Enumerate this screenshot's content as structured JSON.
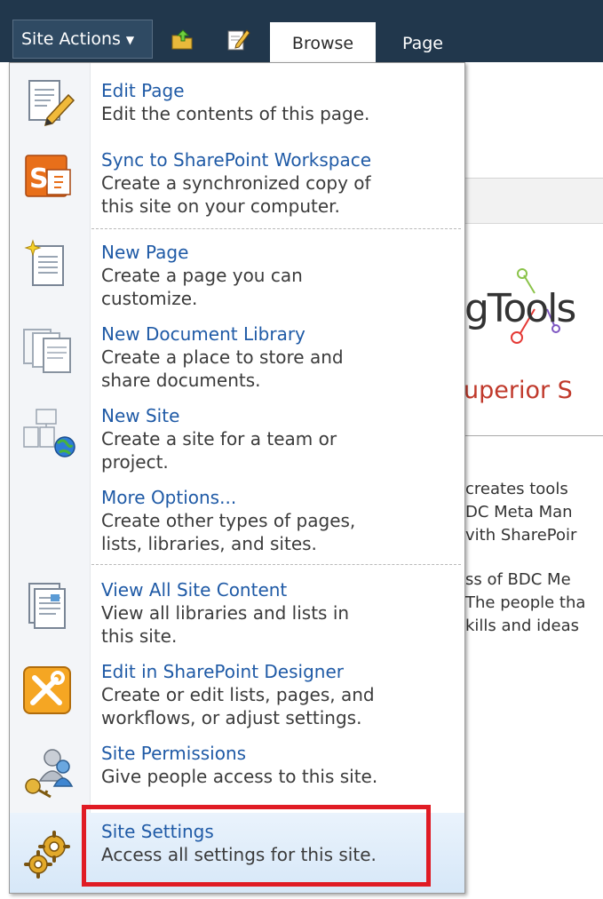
{
  "topbar": {
    "site_actions_label": "Site Actions",
    "tabs": [
      {
        "label": "Browse",
        "selected": true
      },
      {
        "label": "Page",
        "selected": false
      }
    ]
  },
  "background_page": {
    "logo_text": "gTools",
    "headline": "uperior S",
    "paragraph1": [
      "creates tools",
      "DC Meta Man",
      "vith SharePoir"
    ],
    "paragraph2": [
      "ss of BDC Me",
      "The people tha",
      "kills and ideas"
    ]
  },
  "menu": {
    "items": [
      {
        "title": "Edit Page",
        "desc": [
          "Edit the contents of this page."
        ],
        "icon": "edit-page-icon"
      },
      {
        "title": "Sync to SharePoint Workspace",
        "desc": [
          "Create a synchronized copy of",
          "this site on your computer."
        ],
        "icon": "sharepoint-workspace-icon"
      },
      {
        "title": "New Page",
        "desc": [
          "Create a page you can",
          "customize."
        ],
        "icon": "new-page-icon"
      },
      {
        "title": "New Document Library",
        "desc": [
          "Create a place to store and",
          "share documents."
        ],
        "icon": "document-library-icon"
      },
      {
        "title": "New Site",
        "desc": [
          "Create a site for a team or",
          "project."
        ],
        "icon": "new-site-icon"
      },
      {
        "title": "More Options...",
        "desc": [
          "Create other types of pages,",
          "lists, libraries, and sites."
        ],
        "icon": ""
      },
      {
        "title": "View All Site Content",
        "desc": [
          "View all libraries and lists in",
          "this site."
        ],
        "icon": "site-content-icon"
      },
      {
        "title": "Edit in SharePoint Designer",
        "desc": [
          "Create or edit lists, pages, and",
          "workflows, or adjust settings."
        ],
        "icon": "sharepoint-designer-icon"
      },
      {
        "title": "Site Permissions",
        "desc": [
          "Give people access to this site."
        ],
        "icon": "permissions-icon"
      },
      {
        "title": "Site Settings",
        "desc": [
          "Access all settings for this site."
        ],
        "icon": "gears-icon",
        "selected": true
      }
    ]
  },
  "colors": {
    "topbar": "#21374c",
    "link_blue": "#1f5aa6",
    "highlight_red": "#e01b24"
  }
}
